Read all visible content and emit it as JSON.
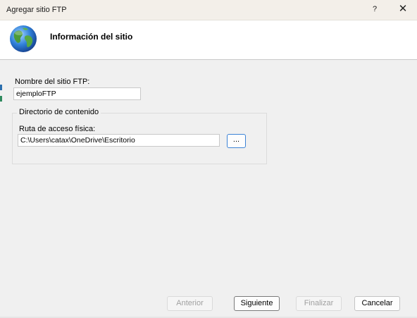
{
  "window": {
    "title": "Agregar sitio FTP",
    "help_label": "?",
    "close_label": "✕"
  },
  "header": {
    "title": "Información del sitio",
    "icon": "globe-icon"
  },
  "form": {
    "site_name_label": "Nombre del sitio FTP:",
    "site_name_value": "ejemploFTP",
    "content_dir_group": "Directorio de contenido",
    "physical_path_label": "Ruta de acceso física:",
    "physical_path_value": "C:\\Users\\catax\\OneDrive\\Escritorio",
    "browse_label": "..."
  },
  "footer": {
    "previous_label": "Anterior",
    "next_label": "Siguiente",
    "finish_label": "Finalizar",
    "cancel_label": "Cancelar"
  },
  "colors": {
    "accent": "#3c83d6",
    "titlebar": "#f3efe9"
  }
}
